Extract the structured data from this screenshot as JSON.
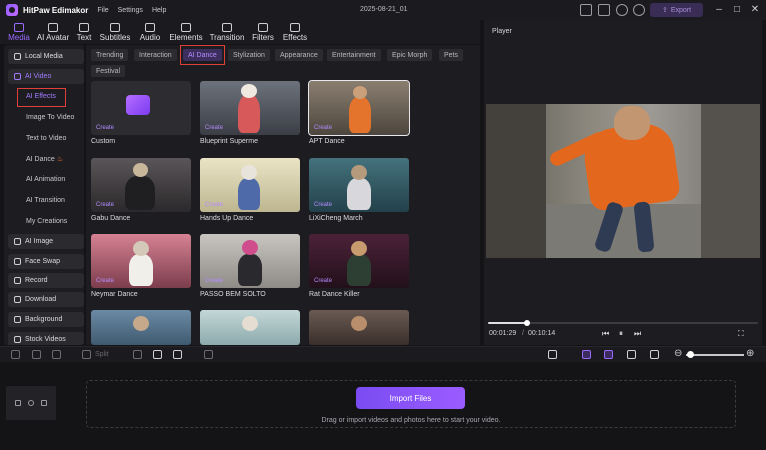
{
  "app": {
    "name": "HitPaw Edimakor",
    "menu": [
      "File",
      "Settings",
      "Help"
    ],
    "document_title": "2025-08-21_01",
    "export_label": "Export"
  },
  "toolbar": {
    "tabs": [
      {
        "label": "Media",
        "icon": "media-icon",
        "active": true
      },
      {
        "label": "AI Avatar",
        "icon": "ai-avatar-icon",
        "active": false
      },
      {
        "label": "Text",
        "icon": "text-icon",
        "active": false
      },
      {
        "label": "Subtitles",
        "icon": "subtitles-icon",
        "active": false
      },
      {
        "label": "Audio",
        "icon": "audio-icon",
        "active": false
      },
      {
        "label": "Elements",
        "icon": "elements-icon",
        "active": false
      },
      {
        "label": "Transition",
        "icon": "transition-icon",
        "active": false
      },
      {
        "label": "Filters",
        "icon": "filters-icon",
        "active": false
      },
      {
        "label": "Effects",
        "icon": "effects-icon",
        "active": false
      }
    ]
  },
  "sidebar": {
    "top_items": [
      {
        "label": "Local Media",
        "icon": "folder-icon",
        "selected": false
      },
      {
        "label": "AI Video",
        "icon": "ai-video-icon",
        "selected": true
      }
    ],
    "sub_items": [
      {
        "label": "AI Effects",
        "active": true
      },
      {
        "label": "Image To Video",
        "active": false
      },
      {
        "label": "Text to Video",
        "active": false
      },
      {
        "label": "AI Dance",
        "active": false
      },
      {
        "label": "AI Animation",
        "active": false
      },
      {
        "label": "AI Transition",
        "active": false
      },
      {
        "label": "My Creations",
        "active": false
      }
    ],
    "bottom_items": [
      {
        "label": "AI Image",
        "icon": "ai-image-icon"
      },
      {
        "label": "Face Swap",
        "icon": "face-swap-icon"
      },
      {
        "label": "Record",
        "icon": "record-icon"
      },
      {
        "label": "Download",
        "icon": "download-icon"
      },
      {
        "label": "Background",
        "icon": "background-icon"
      },
      {
        "label": "Stock Videos",
        "icon": "stock-videos-icon"
      }
    ]
  },
  "categories": [
    {
      "label": "Trending",
      "active": false
    },
    {
      "label": "Interaction",
      "active": false
    },
    {
      "label": "AI Dance",
      "active": true
    },
    {
      "label": "Stylization",
      "active": false
    },
    {
      "label": "Appearance",
      "active": false
    },
    {
      "label": "Entertainment",
      "active": false
    },
    {
      "label": "Epic Morph",
      "active": false
    },
    {
      "label": "Pets",
      "active": false
    },
    {
      "label": "Festival",
      "active": false
    }
  ],
  "effects": [
    {
      "title": "Custom",
      "create": "Create",
      "bg": "#2c2c31"
    },
    {
      "title": "Blueprint Superme",
      "create": "Create",
      "bg": "#4a4e55"
    },
    {
      "title": "APT Dance",
      "create": "Create",
      "bg": "#6e6458"
    },
    {
      "title": "Gabu Dance",
      "create": "Create",
      "bg": "#3d3a3c"
    },
    {
      "title": "Hands Up Dance",
      "create": "Create",
      "bg": "#d8d2b6"
    },
    {
      "title": "LiXiCheng March",
      "create": "Create",
      "bg": "#2f5560"
    },
    {
      "title": "Neymar Dance",
      "create": "Create",
      "bg": "#b05a6a"
    },
    {
      "title": "PASSO BEM SOLTO",
      "create": "Create",
      "bg": "#b4b0aa"
    },
    {
      "title": "Rat Dance Killer",
      "create": "Create",
      "bg": "#3a1c2c"
    },
    {
      "title": "",
      "create": "",
      "bg": "#5f7d96"
    },
    {
      "title": "",
      "create": "",
      "bg": "#a9c3c4"
    },
    {
      "title": "",
      "create": "",
      "bg": "#5c4a44"
    }
  ],
  "player": {
    "title": "Player",
    "current_time": "00:01:29",
    "total_time": "00:10:14",
    "progress": 0.146
  },
  "timeline": {
    "split_label": "Split",
    "import_label": "Import Files",
    "hint": "Drag or import videos and photos here to start your video."
  },
  "colors": {
    "accent": "#9b6bff",
    "highlight": "#e0403a"
  }
}
